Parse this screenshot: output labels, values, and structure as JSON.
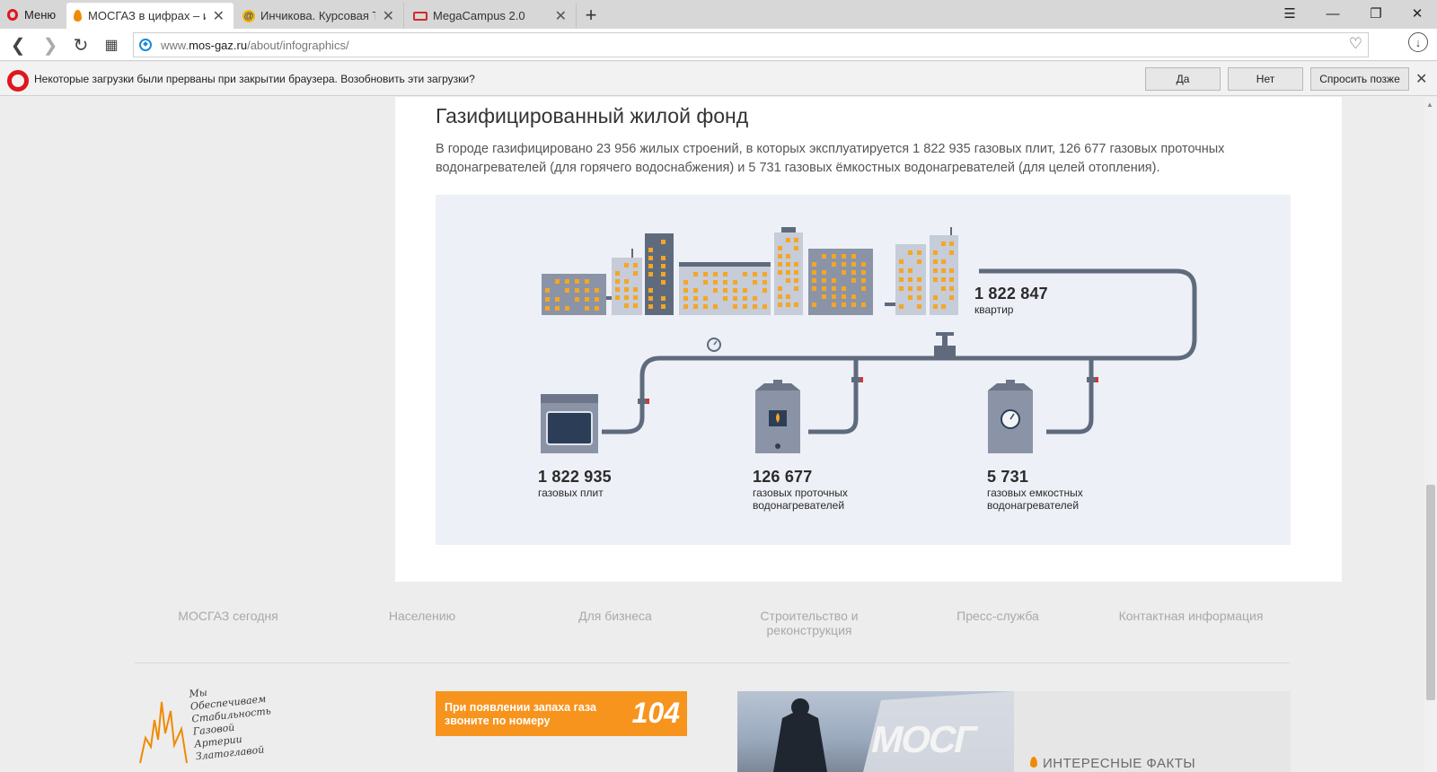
{
  "browser": {
    "menu_label": "Меню",
    "tabs": [
      {
        "title": "МОСГАЗ в цифрах – инфо",
        "active": true
      },
      {
        "title": "Инчикова. Курсовая Теку",
        "active": false
      },
      {
        "title": "MegaCampus 2.0",
        "active": false
      }
    ],
    "url_prefix": "www.",
    "url_domain": "mos-gaz.ru",
    "url_path": "/about/infographics/"
  },
  "infobar": {
    "message": "Некоторые загрузки были прерваны при закрытии браузера. Возобновить эти загрузки?",
    "yes": "Да",
    "no": "Нет",
    "later": "Спросить позже"
  },
  "article": {
    "heading": "Газифицированный жилой фонд",
    "paragraph": "В городе газифицировано 23 956 жилых строений, в которых эксплуатируется 1 822 935 газовых плит, 126 677 газовых проточных водонагревателей (для горячего водоснабжения) и 5 731 газовых ёмкостных водонагревателей (для целей отопления)."
  },
  "infographic": {
    "apartments": {
      "value": "1 822 847",
      "label": "квартир"
    },
    "stoves": {
      "value": "1 822 935",
      "label": "газовых плит"
    },
    "flow_heaters": {
      "value": "126 677",
      "label": "газовых проточных водонагревателей"
    },
    "tank_heaters": {
      "value": "5 731",
      "label": "газовых емкостных водонагревателей"
    }
  },
  "footer": {
    "nav": [
      "МОСГАЗ сегодня",
      "Населению",
      "Для бизнеса",
      "Строительство и реконструкция",
      "Пресс-служба",
      "Контактная информация"
    ],
    "slogan": [
      "Мы",
      "Обеспечиваем",
      "Стабильность",
      "Газовой",
      "Артерии",
      "Златоглавой"
    ],
    "gas_alert_text": "При появлении запаха газа звоните по номеру",
    "gas_alert_number": "104",
    "photo_sign": "МОСГ",
    "facts_label": "ИНТЕРЕСНЫЕ ФАКТЫ"
  },
  "colors": {
    "accent_orange": "#f7941d",
    "pipe": "#5f6b7d",
    "window": "#f5a623",
    "background_panel": "#eef0f7"
  }
}
